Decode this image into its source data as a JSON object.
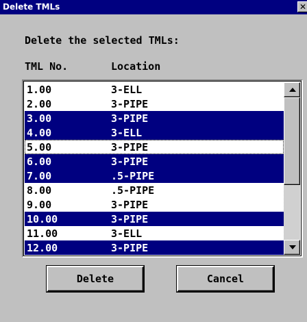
{
  "window": {
    "title": "Delete TMLs",
    "close_label": "✕"
  },
  "prompt": "Delete the selected TMLs:",
  "columns": {
    "tml": "TML No.",
    "location": "Location"
  },
  "rows": [
    {
      "tml": "1.00",
      "location": "3-ELL",
      "selected": false,
      "focused": false
    },
    {
      "tml": "2.00",
      "location": "3-PIPE",
      "selected": false,
      "focused": false
    },
    {
      "tml": "3.00",
      "location": "3-PIPE",
      "selected": true,
      "focused": false
    },
    {
      "tml": "4.00",
      "location": "3-ELL",
      "selected": true,
      "focused": false
    },
    {
      "tml": "5.00",
      "location": "3-PIPE",
      "selected": false,
      "focused": true
    },
    {
      "tml": "6.00",
      "location": "3-PIPE",
      "selected": true,
      "focused": false
    },
    {
      "tml": "7.00",
      "location": ".5-PIPE",
      "selected": true,
      "focused": false
    },
    {
      "tml": "8.00",
      "location": ".5-PIPE",
      "selected": false,
      "focused": false
    },
    {
      "tml": "9.00",
      "location": "3-PIPE",
      "selected": false,
      "focused": false
    },
    {
      "tml": "10.00",
      "location": "3-PIPE",
      "selected": true,
      "focused": false
    },
    {
      "tml": "11.00",
      "location": "3-ELL",
      "selected": false,
      "focused": false
    },
    {
      "tml": "12.00",
      "location": "3-PIPE",
      "selected": true,
      "focused": false
    }
  ],
  "buttons": {
    "delete": "Delete",
    "cancel": "Cancel"
  },
  "colors": {
    "titlebar": "#000080",
    "selection": "#000080",
    "face": "#c0c0c0"
  }
}
